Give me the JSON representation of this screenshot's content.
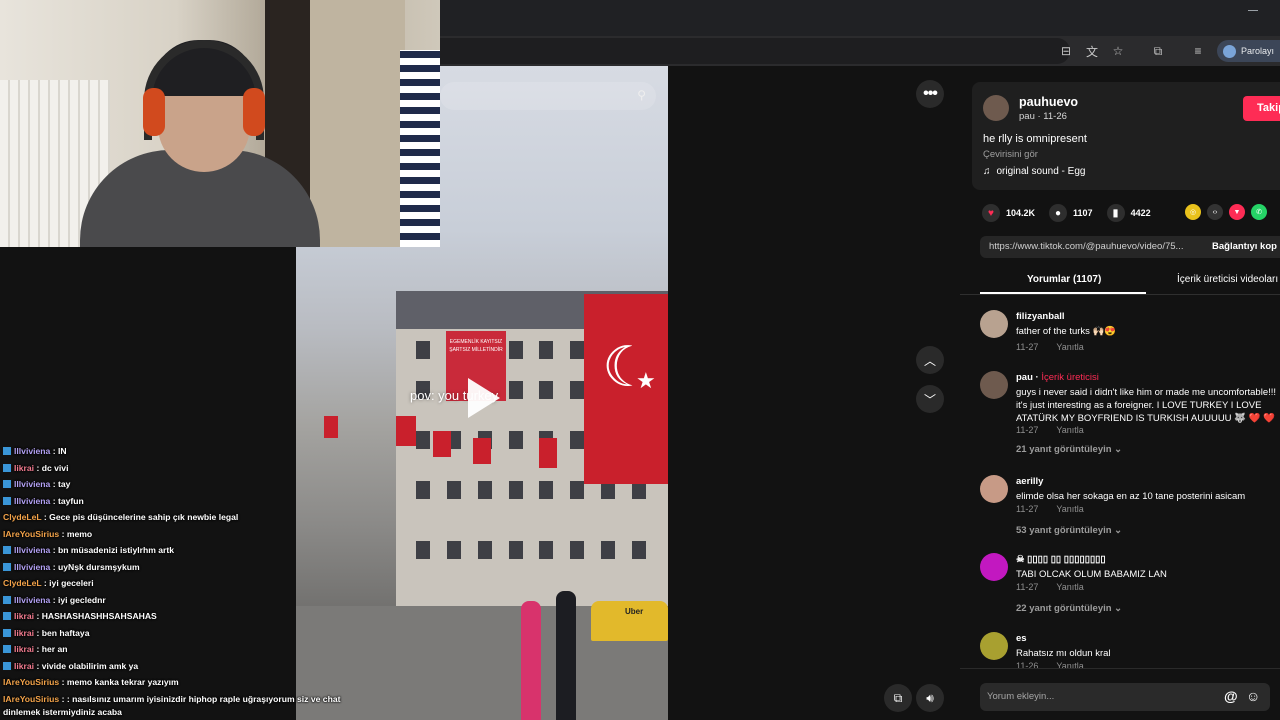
{
  "browser": {
    "profile_label": "Parolayı"
  },
  "video": {
    "overlay_text": "pov: you  turkey",
    "banner_text": "EGEMENLİK KAYITSIZ ŞARTSIZ MİLLETİNDİR",
    "taxi_text": "Uber"
  },
  "chat": {
    "messages": [
      {
        "user": "lllviviena",
        "text": ": IN"
      },
      {
        "user": "Iikrai",
        "text": ": dc vivi"
      },
      {
        "user": "lllviviena",
        "text": ": tay"
      },
      {
        "user": "lllviviena",
        "text": ": tayfun"
      },
      {
        "user": "ClydeLeL",
        "text": ": Gece pis düşüncelerine sahip çık newbie legal"
      },
      {
        "user": "IAreYouSirius",
        "text": ": memo"
      },
      {
        "user": "lllviviena",
        "text": ": bn müsadenizi istiylrhm artk"
      },
      {
        "user": "lllviviena",
        "text": ": uyNşk dursmşykum"
      },
      {
        "user": "ClydeLeL",
        "text": ": iyi geceleri"
      },
      {
        "user": "lllviviena",
        "text": ": iyi geclednr"
      },
      {
        "user": "Iikrai",
        "text": ": HASHASHASHHSAHSAHAS"
      },
      {
        "user": "Iikrai",
        "text": ": ben haftaya"
      },
      {
        "user": "Iikrai",
        "text": ": her an"
      },
      {
        "user": "Iikrai",
        "text": ": vivide olabilirim amk ya"
      },
      {
        "user": "IAreYouSirius",
        "text": ": memo kanka tekrar yazıyım"
      },
      {
        "user": "IAreYouSirius",
        "text": ": : nasılsınız umarım iyisinizdir hiphop raple uğraşıyorum siz ve chat dinlemek istermiydiniz acaba"
      }
    ]
  },
  "post": {
    "author": "pauhuevo",
    "sub": "pau · 11-26",
    "follow_label": "Takip",
    "caption": "he rlly is omnipresent",
    "translate": "Çevirisini gör",
    "sound": "original sound - Egg",
    "likes": "104.2K",
    "comments": "1107",
    "saves": "4422",
    "url": "https://www.tiktok.com/@pauhuevo/video/75...",
    "copy_label": "Bağlantıyı kop",
    "tab_comments": "Yorumlar (1107)",
    "tab_creator": "İçerik üreticisi videoları"
  },
  "comments": [
    {
      "user": "filizyanball",
      "text": "father of the turks 🙌🏻😍",
      "date": "11-27",
      "reply": "Yanıtla"
    },
    {
      "user": "pau",
      "creator": "İçerik üreticisi",
      "text": "guys i never said i didn't like him or made me uncomfortable!!! it's just interesting as a foreigner. I LOVE TURKEY I LOVE ATATÜRK MY BOYFRIEND IS TURKISH AUUUUU 🐺 ❤️ ❤️",
      "date": "11-27",
      "reply": "Yanıtla",
      "replies": "21 yanıt görüntüleyin ⌄"
    },
    {
      "user": "aerilly",
      "text": "elimde olsa her sokaga en az 10 tane posterini asicam",
      "date": "11-27",
      "reply": "Yanıtla",
      "replies": "53 yanıt görüntüleyin ⌄"
    },
    {
      "user": "☠ ▯▯▯▯ ▯▯ ▯▯▯▯▯▯▯▯",
      "text": "TABI OLCAK OLUM BABAMIZ LAN",
      "date": "11-27",
      "reply": "Yanıtla",
      "replies": "22 yanıt görüntüleyin ⌄"
    },
    {
      "user": "es",
      "text": "Rahatsız mı oldun kral",
      "date": "11-26",
      "reply": "Yanıtla"
    }
  ],
  "comment_input": {
    "placeholder": "Yorum ekleyin..."
  },
  "colors": {
    "accent": "#fe2c55",
    "chat_purple": "#b4a2f5",
    "chat_pink": "#f27b8f",
    "chat_orange": "#f3a34a"
  }
}
